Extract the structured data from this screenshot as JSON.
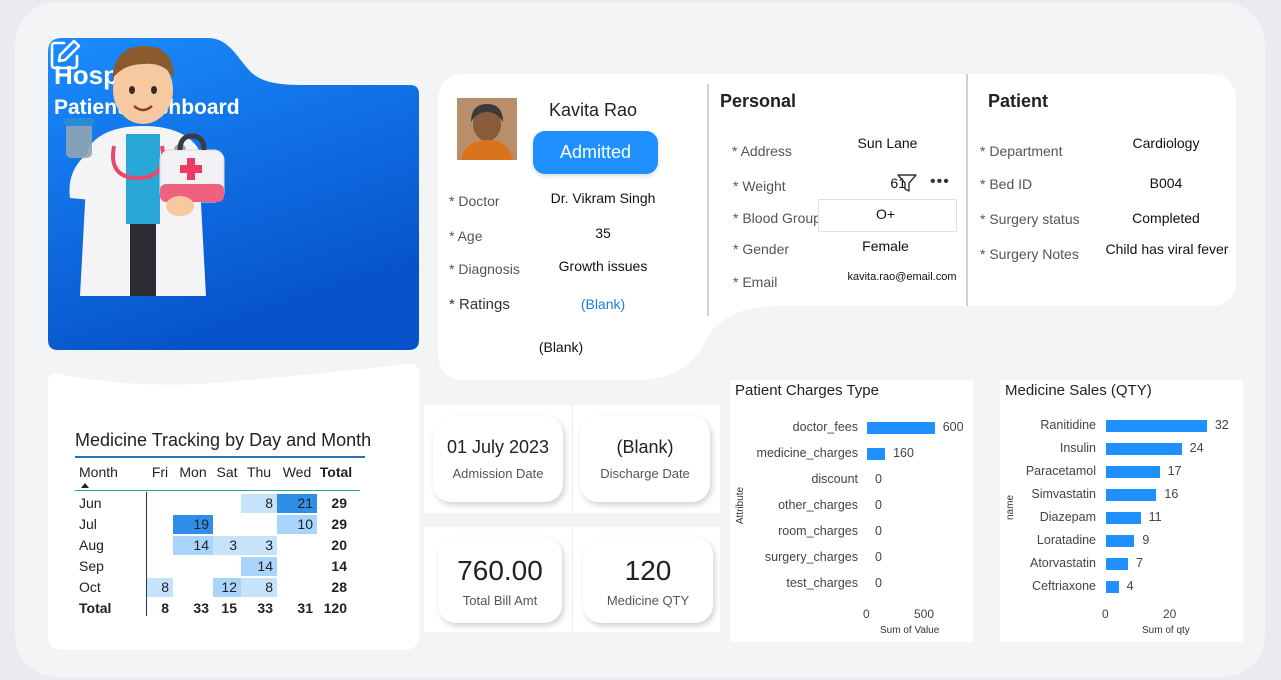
{
  "hero": {
    "title": "Hospital",
    "subtitle": "Patient Dashboard"
  },
  "patient": {
    "name": "Kavita Rao",
    "status": "Admitted",
    "fields_left": [
      {
        "label": "* Doctor",
        "value": "Dr. Vikram Singh"
      },
      {
        "label": "* Age",
        "value": "35"
      },
      {
        "label": "* Diagnosis",
        "value": "Growth issues"
      },
      {
        "label": "* Ratings",
        "value": "(Blank)"
      }
    ],
    "extra_blank": "(Blank)"
  },
  "personal": {
    "heading": "Personal",
    "fields": [
      {
        "label": "* Address",
        "value": "Sun Lane"
      },
      {
        "label": "* Weight",
        "value": "61"
      },
      {
        "label": "* Blood Group",
        "value": "O+"
      },
      {
        "label": "* Gender",
        "value": "Female"
      },
      {
        "label": "* Email",
        "value": "kavita.rao@email.com"
      }
    ]
  },
  "patient_info": {
    "heading": "Patient",
    "fields": [
      {
        "label": "* Department",
        "value": "Cardiology"
      },
      {
        "label": "* Bed ID",
        "value": "B004"
      },
      {
        "label": "* Surgery status",
        "value": "Completed"
      },
      {
        "label": "* Surgery Notes",
        "value": "Child has viral fever"
      }
    ]
  },
  "kpis": {
    "admission_date": {
      "value": "01 July 2023",
      "label": "Admission Date"
    },
    "discharge_date": {
      "value": "(Blank)",
      "label": "Discharge Date"
    },
    "total_bill": {
      "value": "760.00",
      "label": "Total Bill Amt"
    },
    "medicine_qty": {
      "value": "120",
      "label": "Medicine QTY"
    }
  },
  "tracking": {
    "title": "Medicine Tracking by Day and Month",
    "headers": [
      "Month",
      "Fri",
      "Mon",
      "Sat",
      "Thu",
      "Wed",
      "Total"
    ],
    "rows": [
      {
        "month": "Jun",
        "cells": [
          "",
          "",
          "",
          "8",
          "21"
        ],
        "total": "29"
      },
      {
        "month": "Jul",
        "cells": [
          "",
          "19",
          "",
          "",
          "10"
        ],
        "total": "29"
      },
      {
        "month": "Aug",
        "cells": [
          "",
          "14",
          "3",
          "3",
          ""
        ],
        "total": "20"
      },
      {
        "month": "Sep",
        "cells": [
          "",
          "",
          "",
          "14",
          ""
        ],
        "total": "14"
      },
      {
        "month": "Oct",
        "cells": [
          "8",
          "",
          "12",
          "8",
          ""
        ],
        "total": "28"
      }
    ],
    "total_row": {
      "month": "Total",
      "cells": [
        "8",
        "33",
        "15",
        "33",
        "31"
      ],
      "total": "120"
    }
  },
  "chart_data": [
    {
      "type": "bar",
      "title": "Patient Charges Type",
      "ylabel": "Attribute",
      "xlabel": "Sum of Value",
      "categories": [
        "doctor_fees",
        "medicine_charges",
        "discount",
        "other_charges",
        "room_charges",
        "surgery_charges",
        "test_charges"
      ],
      "values": [
        600,
        160,
        0,
        0,
        0,
        0,
        0
      ],
      "xticks": [
        "0",
        "500"
      ],
      "xlim": [
        0,
        620
      ]
    },
    {
      "type": "bar",
      "title": "Medicine Sales (QTY)",
      "ylabel": "name",
      "xlabel": "Sum of qty",
      "categories": [
        "Ranitidine",
        "Insulin",
        "Paracetamol",
        "Simvastatin",
        "Diazepam",
        "Loratadine",
        "Atorvastatin",
        "Ceftriaxone"
      ],
      "values": [
        32,
        24,
        17,
        16,
        11,
        9,
        7,
        4
      ],
      "xticks": [
        "0",
        "20"
      ],
      "xlim": [
        0,
        33
      ]
    }
  ]
}
